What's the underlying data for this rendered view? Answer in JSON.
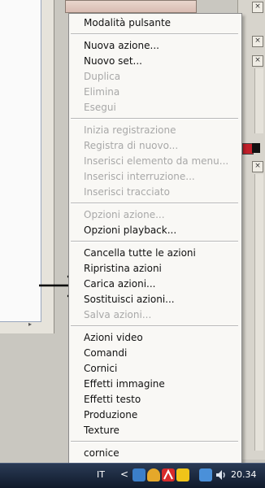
{
  "menu": {
    "items": [
      {
        "label": "Modalità pulsante",
        "enabled": true
      },
      {
        "label": "Nuova azione...",
        "enabled": true
      },
      {
        "label": "Nuovo set...",
        "enabled": true
      },
      {
        "label": "Duplica",
        "enabled": false
      },
      {
        "label": "Elimina",
        "enabled": false
      },
      {
        "label": "Esegui",
        "enabled": false
      },
      {
        "label": "Inizia registrazione",
        "enabled": false
      },
      {
        "label": "Registra di nuovo...",
        "enabled": false
      },
      {
        "label": "Inserisci elemento da menu...",
        "enabled": false
      },
      {
        "label": "Inserisci interruzione...",
        "enabled": false
      },
      {
        "label": "Inserisci tracciato",
        "enabled": false
      },
      {
        "label": "Opzioni azione...",
        "enabled": false
      },
      {
        "label": "Opzioni playback...",
        "enabled": true
      },
      {
        "label": "Cancella tutte le azioni",
        "enabled": true
      },
      {
        "label": "Ripristina azioni",
        "enabled": true
      },
      {
        "label": "Carica azioni...",
        "enabled": true
      },
      {
        "label": "Sostituisci azioni...",
        "enabled": true
      },
      {
        "label": "Salva azioni...",
        "enabled": false
      },
      {
        "label": "Azioni video",
        "enabled": true
      },
      {
        "label": "Comandi",
        "enabled": true
      },
      {
        "label": "Cornici",
        "enabled": true
      },
      {
        "label": "Effetti immagine",
        "enabled": true
      },
      {
        "label": "Effetti testo",
        "enabled": true
      },
      {
        "label": "Produzione",
        "enabled": true
      },
      {
        "label": "Texture",
        "enabled": true
      },
      {
        "label": "cornice",
        "enabled": true
      }
    ]
  },
  "taskbar": {
    "language": "IT",
    "expand_glyph": "<",
    "clock": "20.34",
    "tray_icons": [
      "network-users-icon",
      "notification-bell-icon",
      "antivirus-icon",
      "battery-icon",
      "network-icon",
      "volume-icon"
    ]
  },
  "panels": {
    "close_glyph": "×",
    "scroll_glyph": "▾"
  },
  "colors": {
    "foreground_swatch": "#c2202a",
    "menu_background": "#f9f8f5",
    "disabled_text": "#a8a8a8",
    "taskbar": "#1a2740"
  }
}
